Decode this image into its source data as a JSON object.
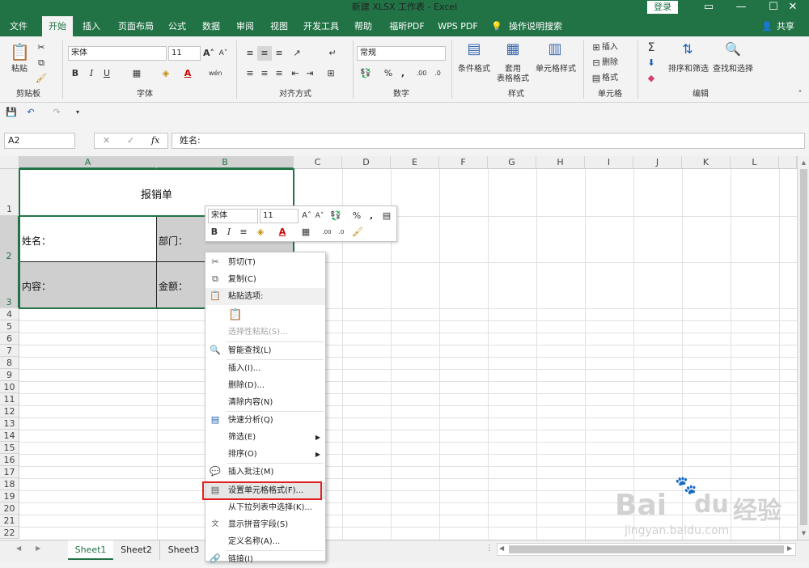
{
  "window": {
    "title": "新建 XLSX 工作表 - Excel",
    "login": "登录"
  },
  "tabs": [
    "文件",
    "开始",
    "插入",
    "页面布局",
    "公式",
    "数据",
    "审阅",
    "视图",
    "开发工具",
    "帮助",
    "福昕PDF",
    "WPS PDF",
    "操作说明搜索"
  ],
  "share": "共享",
  "ribbon": {
    "clipboard": {
      "label": "剪贴板",
      "paste": "粘贴"
    },
    "font": {
      "label": "字体",
      "name": "宋体",
      "size": "11",
      "pinyin": "wén"
    },
    "align": {
      "label": "对齐方式"
    },
    "number": {
      "label": "数字",
      "format": "常规"
    },
    "styles": {
      "label": "样式",
      "cond": "条件格式",
      "table1": "套用",
      "table2": "表格格式",
      "cellstyle": "单元格样式"
    },
    "cells": {
      "label": "单元格",
      "insert": "插入",
      "delete": "删除",
      "format": "格式"
    },
    "edit": {
      "label": "编辑",
      "sort": "排序和筛选",
      "find": "查找和选择"
    }
  },
  "namebox": "A2",
  "formula": "姓名:",
  "columns": [
    "A",
    "B",
    "C",
    "D",
    "E",
    "F",
    "G",
    "H",
    "I",
    "J",
    "K",
    "L"
  ],
  "rows": [
    "1",
    "2",
    "3",
    "4",
    "5",
    "6",
    "7",
    "8",
    "9",
    "10",
    "11",
    "12",
    "13",
    "14",
    "15",
    "16",
    "17",
    "18",
    "19",
    "20",
    "21",
    "22"
  ],
  "cells": {
    "title": "报销单",
    "name": "姓名：",
    "dept": "部门：",
    "content": "内容：",
    "amount": "金额："
  },
  "minitoolbar": {
    "font": "宋体",
    "size": "11"
  },
  "context_menu": [
    {
      "label": "剪切(T)",
      "icon": "scissors-icon",
      "disabled": false
    },
    {
      "label": "复制(C)",
      "icon": "copy-icon",
      "disabled": false
    },
    {
      "label": "粘贴选项:",
      "icon": "paste-icon",
      "disabled": false
    },
    {
      "label": "",
      "icon": "paste-clipboard-icon",
      "disabled": true
    },
    {
      "label": "选择性粘贴(S)...",
      "icon": "",
      "disabled": true
    },
    {
      "label": "智能查找(L)",
      "icon": "smart-lookup-icon",
      "disabled": false
    },
    {
      "label": "插入(I)...",
      "icon": "",
      "disabled": false
    },
    {
      "label": "删除(D)...",
      "icon": "",
      "disabled": false
    },
    {
      "label": "清除内容(N)",
      "icon": "",
      "disabled": false
    },
    {
      "label": "快速分析(Q)",
      "icon": "quick-analysis-icon",
      "disabled": false
    },
    {
      "label": "筛选(E)",
      "icon": "",
      "disabled": false
    },
    {
      "label": "排序(O)",
      "icon": "",
      "disabled": false
    },
    {
      "label": "插入批注(M)",
      "icon": "comment-icon",
      "disabled": false
    },
    {
      "label": "设置单元格格式(F)...",
      "icon": "format-cells-icon",
      "disabled": false
    },
    {
      "label": "从下拉列表中选择(K)...",
      "icon": "",
      "disabled": false
    },
    {
      "label": "显示拼音字段(S)",
      "icon": "pinyin-icon",
      "disabled": false
    },
    {
      "label": "定义名称(A)...",
      "icon": "",
      "disabled": false
    },
    {
      "label": "链接(I)",
      "icon": "link-icon",
      "disabled": false
    }
  ],
  "sheets": [
    "Sheet1",
    "Sheet2",
    "Sheet3"
  ],
  "watermark": {
    "brand": "Bai",
    "paw": "du",
    "cn": "经验",
    "url": "jingyan.baidu.com"
  },
  "colors": {
    "brand": "#217346",
    "highlight": "#e02020"
  }
}
